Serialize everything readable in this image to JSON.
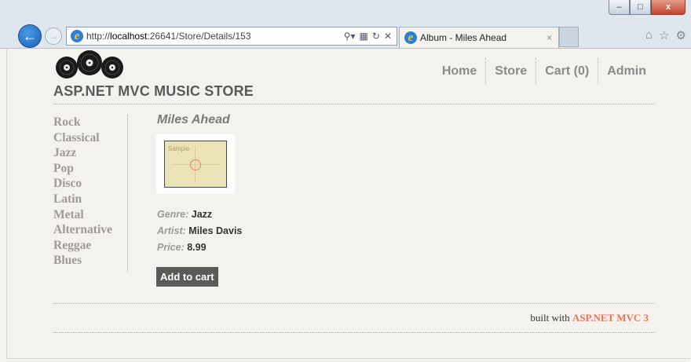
{
  "browser": {
    "url_prefix": "http://",
    "url_host": "localhost",
    "url_rest": ":26641/Store/Details/153",
    "tab_title": "Album - Miles Ahead",
    "tab_close": "×",
    "window_buttons": {
      "minimize": "–",
      "maximize": "□",
      "close": "x"
    },
    "icons": [
      "back-arrow-icon",
      "forward-arrow-icon",
      "ie-logo-icon",
      "search-icon",
      "compat-view-icon",
      "refresh-icon",
      "stop-icon",
      "home-icon",
      "favorites-star-icon",
      "settings-gear-icon"
    ],
    "accent_color": "#1b5fb4"
  },
  "site": {
    "title": "ASP.NET MVC MUSIC STORE",
    "nav": [
      {
        "label": "Home"
      },
      {
        "label": "Store"
      },
      {
        "label": "Cart (0)"
      },
      {
        "label": "Admin"
      }
    ]
  },
  "genres": [
    "Rock",
    "Classical",
    "Jazz",
    "Pop",
    "Disco",
    "Latin",
    "Metal",
    "Alternative",
    "Reggae",
    "Blues"
  ],
  "album": {
    "title": "Miles Ahead",
    "art_text": "Sample",
    "genre_label": "Genre:",
    "genre": "Jazz",
    "artist_label": "Artist:",
    "artist": "Miles Davis",
    "price_label": "Price:",
    "price": "8.99",
    "add_to_cart": "Add to cart"
  },
  "footer": {
    "prefix": "built with",
    "brand": "ASP.NET MVC 3",
    "brand_color": "#e8755a"
  }
}
